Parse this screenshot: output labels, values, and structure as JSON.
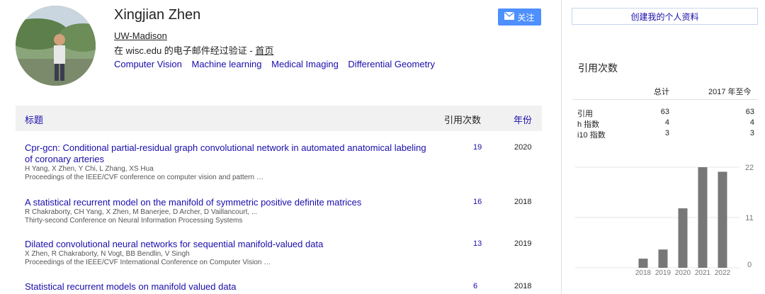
{
  "profile": {
    "name": "Xingjian Zhen",
    "affiliation": "UW-Madison",
    "verified_text": "在 wisc.edu 的电子邮件经过验证 - ",
    "homepage_label": "首页",
    "interests": [
      "Computer Vision",
      "Machine learning",
      "Medical Imaging",
      "Differential Geometry"
    ],
    "follow_label": "关注"
  },
  "create_profile_label": "创建我的个人资料",
  "table": {
    "title_header": "标题",
    "cited_header": "引用次数",
    "year_header": "年份",
    "rows": [
      {
        "title": "Cpr-gcn: Conditional partial-residual graph convolutional network in automated anatomical labeling of coronary arteries",
        "authors": "H Yang, X Zhen, Y Chi, L Zhang, XS Hua",
        "venue": "Proceedings of the IEEE/CVF conference on computer vision and pattern …",
        "cited": "19",
        "year": "2020"
      },
      {
        "title": "A statistical recurrent model on the manifold of symmetric positive definite matrices",
        "authors": "R Chakraborty, CH Yang, X Zhen, M Banerjee, D Archer, D Vaillancourt, ...",
        "venue": "Thirty-second Conference on Neural Information Processing Systems",
        "cited": "16",
        "year": "2018"
      },
      {
        "title": "Dilated convolutional neural networks for sequential manifold-valued data",
        "authors": "X Zhen, R Chakraborty, N Vogt, BB Bendlin, V Singh",
        "venue": "Proceedings of the IEEE/CVF International Conference on Computer Vision …",
        "cited": "13",
        "year": "2019"
      },
      {
        "title": "Statistical recurrent models on manifold valued data",
        "authors": "",
        "venue": "",
        "cited": "6",
        "year": "2018"
      }
    ]
  },
  "citations": {
    "heading": "引用次数",
    "col_total": "总计",
    "col_since": "2017 年至今",
    "rows": [
      {
        "label": "引用",
        "total": "63",
        "since": "63"
      },
      {
        "label": "h 指数",
        "total": "4",
        "since": "4"
      },
      {
        "label": "i10 指数",
        "total": "3",
        "since": "3"
      }
    ]
  },
  "colors": {
    "link": "#1a0dab",
    "button": "#4d90fe",
    "bar": "#777777"
  },
  "chart_data": {
    "type": "bar",
    "categories": [
      "2018",
      "2019",
      "2020",
      "2021",
      "2022"
    ],
    "values": [
      2,
      4,
      13,
      22,
      21
    ],
    "yticks": [
      "22",
      "11",
      "0"
    ],
    "ylim": [
      0,
      22
    ],
    "grid": true
  }
}
